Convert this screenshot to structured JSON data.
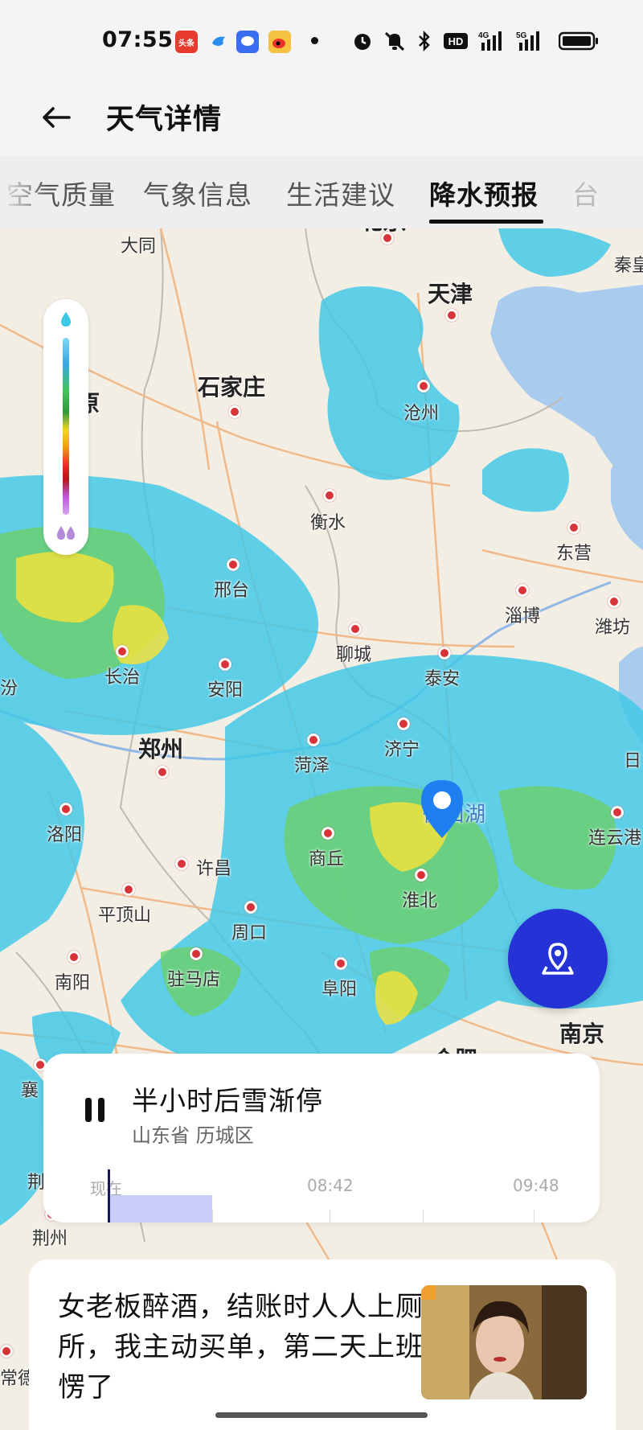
{
  "status_bar": {
    "time": "07:55",
    "app_badge_1": "头条",
    "network": "HD",
    "signal_1": "4G",
    "signal_2": "5G"
  },
  "header": {
    "back_icon": "arrow-left-icon",
    "title": "天气详情"
  },
  "tabs": {
    "items": [
      {
        "label": "空气质量"
      },
      {
        "label": "气象信息"
      },
      {
        "label": "生活建议"
      },
      {
        "label": "降水预报"
      },
      {
        "label": "台"
      }
    ],
    "active_index": 3
  },
  "map": {
    "cities": [
      {
        "name": "北京"
      },
      {
        "name": "大同"
      },
      {
        "name": "天津"
      },
      {
        "name": "秦皇"
      },
      {
        "name": "石家庄"
      },
      {
        "name": "沧州"
      },
      {
        "name": "衡水"
      },
      {
        "name": "东营"
      },
      {
        "name": "邢台"
      },
      {
        "name": "淄博"
      },
      {
        "name": "潍坊"
      },
      {
        "name": "聊城"
      },
      {
        "name": "泰安"
      },
      {
        "name": "长治"
      },
      {
        "name": "安阳"
      },
      {
        "name": "郑州"
      },
      {
        "name": "菏泽"
      },
      {
        "name": "济宁"
      },
      {
        "name": "洛阳"
      },
      {
        "name": "微山湖"
      },
      {
        "name": "连云港"
      },
      {
        "name": "许昌"
      },
      {
        "name": "商丘"
      },
      {
        "name": "平顶山"
      },
      {
        "name": "淮北"
      },
      {
        "name": "周口"
      },
      {
        "name": "南阳"
      },
      {
        "name": "驻马店"
      },
      {
        "name": "阜阳"
      },
      {
        "name": "南京"
      },
      {
        "name": "合肥"
      },
      {
        "name": "襄"
      },
      {
        "name": "荆州"
      },
      {
        "name": "日"
      },
      {
        "name": "原"
      },
      {
        "name": "汾"
      },
      {
        "name": "荆"
      },
      {
        "name": "常德"
      }
    ],
    "legend_top_icon": "water-drop-icon",
    "legend_bottom_icon": "double-drop-icon",
    "pin_icon": "location-pin-icon",
    "locate_icon": "locate-me-icon"
  },
  "forecast": {
    "title": "半小时后雪渐停",
    "location": "山东省 历城区",
    "ticks": [
      "现在",
      "08:42",
      "09:48"
    ]
  },
  "news": {
    "text": "女老板醉酒，结账时人人上厕所，我主动买单，第二天上班愣了"
  },
  "colors": {
    "accent": "#2432d6",
    "rain_light": "#3ec8e8",
    "rain_medium": "#6cd06a",
    "rain_heavy": "#f2e23c",
    "city_dot": "#d9333a"
  }
}
